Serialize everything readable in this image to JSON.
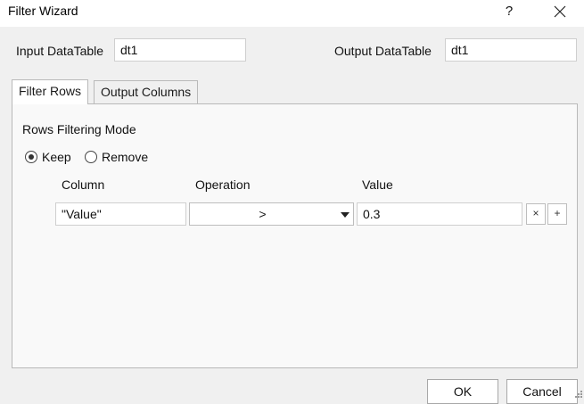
{
  "window": {
    "title": "Filter Wizard",
    "help_label": "?",
    "close_icon": "close-icon"
  },
  "io": {
    "input_label": "Input DataTable",
    "input_value": "dt1",
    "output_label": "Output DataTable",
    "output_value": "dt1"
  },
  "tabs": [
    {
      "label": "Filter Rows",
      "active": true
    },
    {
      "label": "Output Columns",
      "active": false
    }
  ],
  "filter": {
    "mode_label": "Rows Filtering Mode",
    "modes": [
      {
        "label": "Keep",
        "checked": true
      },
      {
        "label": "Remove",
        "checked": false
      }
    ],
    "headers": {
      "column": "Column",
      "operation": "Operation",
      "value": "Value"
    },
    "rows": [
      {
        "column": "\"Value\"",
        "operation": ">",
        "value": "0.3",
        "remove_label": "×",
        "add_label": "+"
      }
    ]
  },
  "footer": {
    "ok_label": "OK",
    "cancel_label": "Cancel"
  }
}
